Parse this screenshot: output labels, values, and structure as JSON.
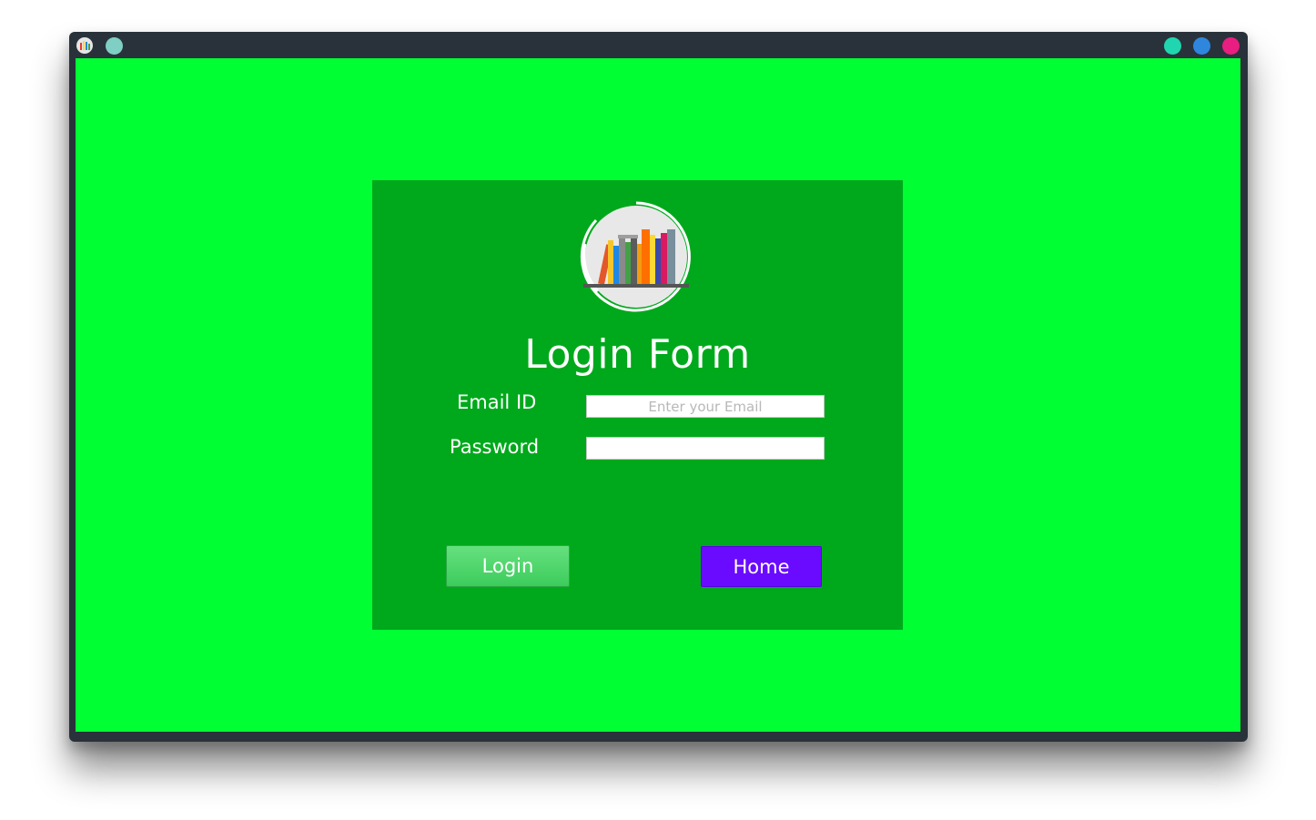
{
  "window": {
    "icon": "books-app-icon",
    "controls": [
      {
        "name": "window-control-teal-light",
        "color": "#7fcfc4"
      },
      {
        "name": "minimize-button",
        "color": "#1fd6b0"
      },
      {
        "name": "maximize-button",
        "color": "#2f86dd"
      },
      {
        "name": "close-button",
        "color": "#e91e80"
      }
    ]
  },
  "colors": {
    "background": "#00ff33",
    "panel": "#00a91b",
    "login_button": "#4fd86a",
    "home_button": "#6a0bff"
  },
  "form": {
    "logo_icon": "bookshelf-logo-icon",
    "title": "Login Form",
    "email_label": "Email ID",
    "email_placeholder": "Enter your Email",
    "email_value": "",
    "password_label": "Password",
    "password_value": "",
    "login_label": "Login",
    "home_label": "Home"
  }
}
